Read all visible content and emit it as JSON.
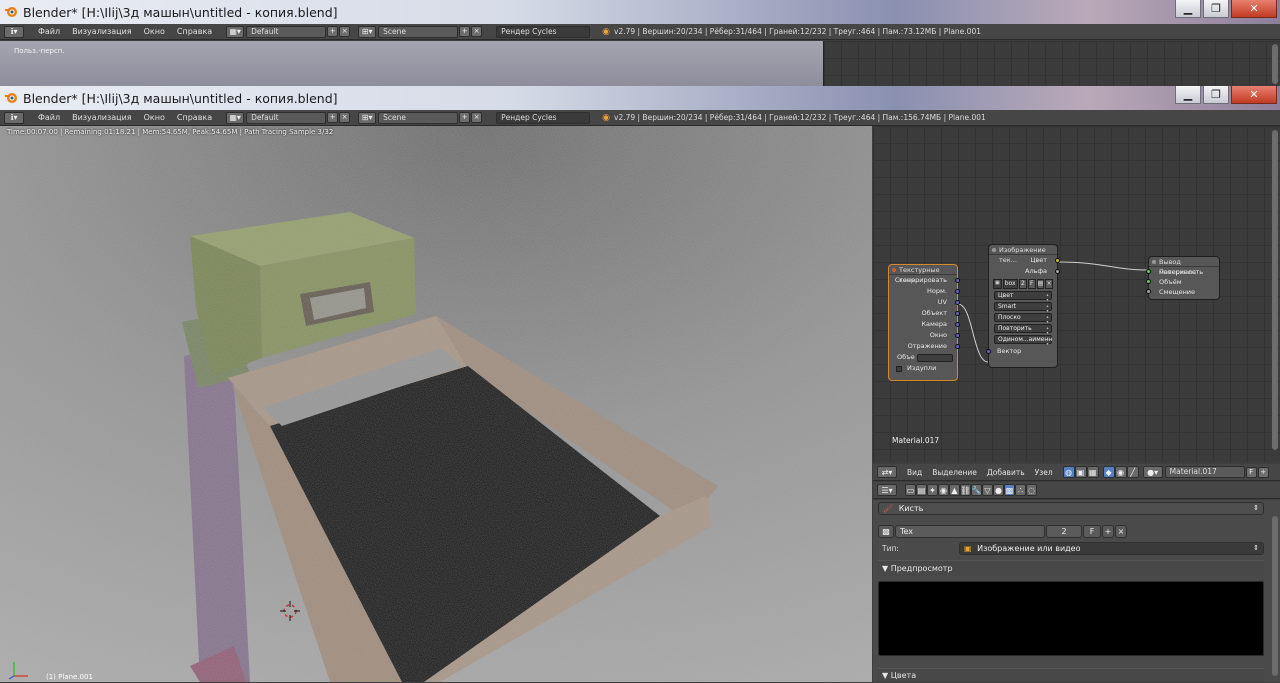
{
  "top_window": {
    "title": "Blender* [H:\\Ilij\\3д машын\\untitled - копия.blend]",
    "menu": [
      "Файл",
      "Визуализация",
      "Окно",
      "Справка"
    ],
    "layout": "Default",
    "scene": "Scene",
    "engine": "Рендер Cycles",
    "stats": "v2.79 | Вершин:20/234 | Рёбер:31/464 | Граней:12/232 | Треуг.:464 | Пам.:73.12МБ | Plane.001",
    "viewport_label": "Польз.-персп."
  },
  "main_window": {
    "title": "Blender* [H:\\Ilij\\3д машын\\untitled - копия.blend]",
    "menu": [
      "Файл",
      "Визуализация",
      "Окно",
      "Справка"
    ],
    "layout": "Default",
    "scene": "Scene",
    "engine": "Рендер Cycles",
    "stats": "v2.79 | Вершин:20/234 | Рёбер:31/464 | Граней:12/232 | Треуг.:464 | Пам.:156.74МБ | Plane.001"
  },
  "viewport": {
    "render_status": "Time:00:07.00 | Remaining:01:18.21 | Mem:54.65M, Peak:54.65M | Path Tracing Sample 3/32",
    "object_label": "(1) Plane.001"
  },
  "node_editor": {
    "material_label": "Material.017",
    "tex_coord_node": {
      "title": "Текстурные коор...",
      "outputs": [
        "Сгенерировать",
        "Норм.",
        "UV",
        "Объект",
        "Камера",
        "Окно",
        "Отражение"
      ],
      "object_label": "Объе",
      "checkbox_label": "Издупли"
    },
    "image_node": {
      "title": "Изображение тек...",
      "outputs": [
        "Цвет",
        "Альфа"
      ],
      "image_name": "box",
      "users": "2",
      "fake_user": "F",
      "dropdowns": [
        "Цвет",
        "Smart",
        "Плоско",
        "Повторить",
        "Одином...аименн"
      ],
      "input": "Вектор"
    },
    "output_node": {
      "title": "Вывод материала",
      "inputs": [
        "Поверхность",
        "Объём",
        "Смещение"
      ]
    },
    "header": {
      "menu": [
        "Вид",
        "Выделение",
        "Добавить",
        "Узел"
      ],
      "material": "Material.017",
      "fake": "F"
    }
  },
  "properties": {
    "brush_label": "Кисть",
    "texture_name": "Tex",
    "texture_users": "2",
    "texture_fake": "F",
    "type_label": "Тип:",
    "type_value": "Изображение или видео",
    "preview_label": "Предпросмотр",
    "colors_label": "Цвета"
  },
  "colors": {
    "accent_orange": "#f0a035",
    "socket_yellow": "#c7c729",
    "socket_green": "#63c763",
    "socket_purple": "#6363c7",
    "socket_grey": "#a1a1a1"
  }
}
